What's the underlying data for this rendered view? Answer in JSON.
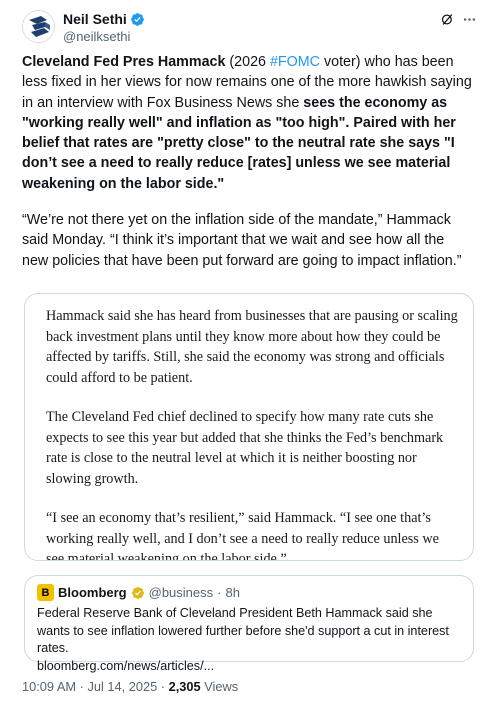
{
  "author": {
    "display_name": "Neil Sethi",
    "handle": "@neilksethi"
  },
  "tweet": {
    "p1": {
      "bold_a": "Cleveland Fed Pres Hammack",
      "plain_a": " (2026 ",
      "hashtag": "#FOMC",
      "plain_b": " voter) who has been less fixed in her views for now remains one of the more hawkish saying in an interview with Fox Business News she ",
      "bold_b": "sees the economy as \"working really well\" and inflation as \"too high\". Paired with her belief that rates are \"pretty close\" to the neutral rate she says \"I don’t see a need to really reduce [rates] unless we see material weakening on the labor side.\""
    },
    "p2": {
      "plain_a": "“We’re not there yet on the inflation side of the mandate,” Hammack said Monday. ",
      "bold_a": "“I think it’s important that we wait and see how all the new policies that have been put forward are going to impact inflation.”"
    }
  },
  "article_image": {
    "p1": "Hammack said she has heard from businesses that are pausing or scaling back investment plans until they know more about how they could be affected by tariffs. Still, she said the economy was strong and officials could afford to be patient.",
    "p2": "The Cleveland Fed chief declined to specify how many rate cuts she expects to see this year but added that she thinks the Fed’s benchmark rate is close to the neutral level at which it is neither boosting nor slowing growth.",
    "p3": "“I see an economy that’s resilient,” said Hammack. “I see one that’s working really well, and I don’t see a need to really reduce unless we see material weakening on the labor side.”"
  },
  "quoted": {
    "logo_letter": "B",
    "name": "Bloomberg",
    "handle": "@business",
    "separator": "·",
    "time": "8h",
    "text": "Federal Reserve Bank of Cleveland President Beth Hammack said she wants to see inflation lowered further before she'd support a cut in interest rates.",
    "link": "bloomberg.com/news/articles/..."
  },
  "footer": {
    "time": "10:09 AM",
    "sep": "·",
    "date": "Jul 14, 2025",
    "sep2": "·",
    "views_count": "2,305",
    "views_label": "Views"
  },
  "colors": {
    "accent": "#1d9bf0",
    "muted": "#536471",
    "text": "#0f1419",
    "bloomberg_gold": "#f2c200"
  },
  "icons": [
    "avatar-logo",
    "verified-badge-icon",
    "grok-icon",
    "more-icon",
    "gold-check-icon"
  ]
}
